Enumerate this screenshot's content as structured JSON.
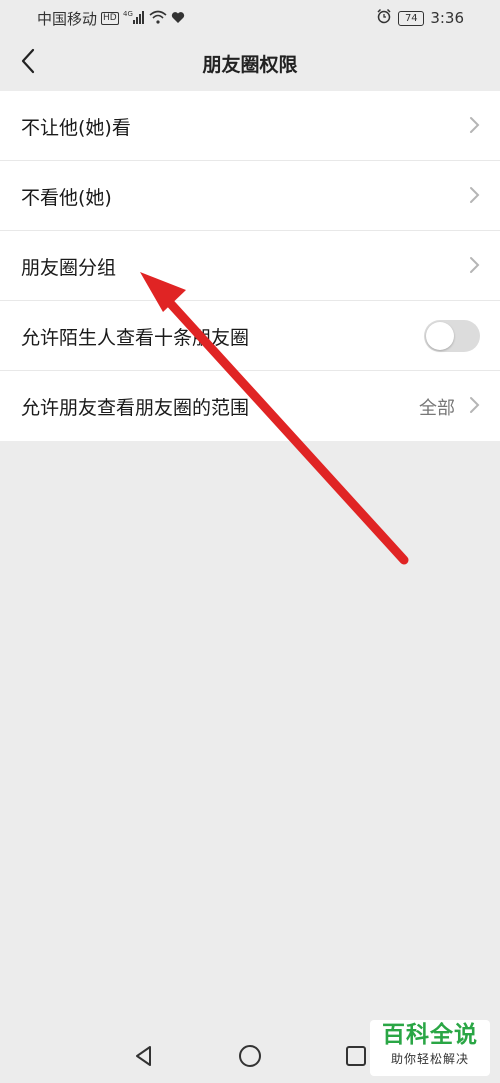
{
  "status_bar": {
    "carrier": "中国移动",
    "hd": "HD",
    "network": "4G",
    "battery": "74",
    "time": "3:36"
  },
  "header": {
    "title": "朋友圈权限"
  },
  "settings": [
    {
      "label": "不让他(她)看",
      "type": "link"
    },
    {
      "label": "不看他(她)",
      "type": "link"
    },
    {
      "label": "朋友圈分组",
      "type": "link"
    },
    {
      "label": "允许陌生人查看十条朋友圈",
      "type": "toggle",
      "enabled": false
    },
    {
      "label": "允许朋友查看朋友圈的范围",
      "type": "link",
      "value": "全部"
    }
  ],
  "annotation": {
    "color": "#e02424"
  },
  "watermark": {
    "title": "百科全说",
    "subtitle": "助你轻松解决"
  },
  "colors": {
    "accent_green": "#2aa645",
    "background": "#ececec"
  }
}
